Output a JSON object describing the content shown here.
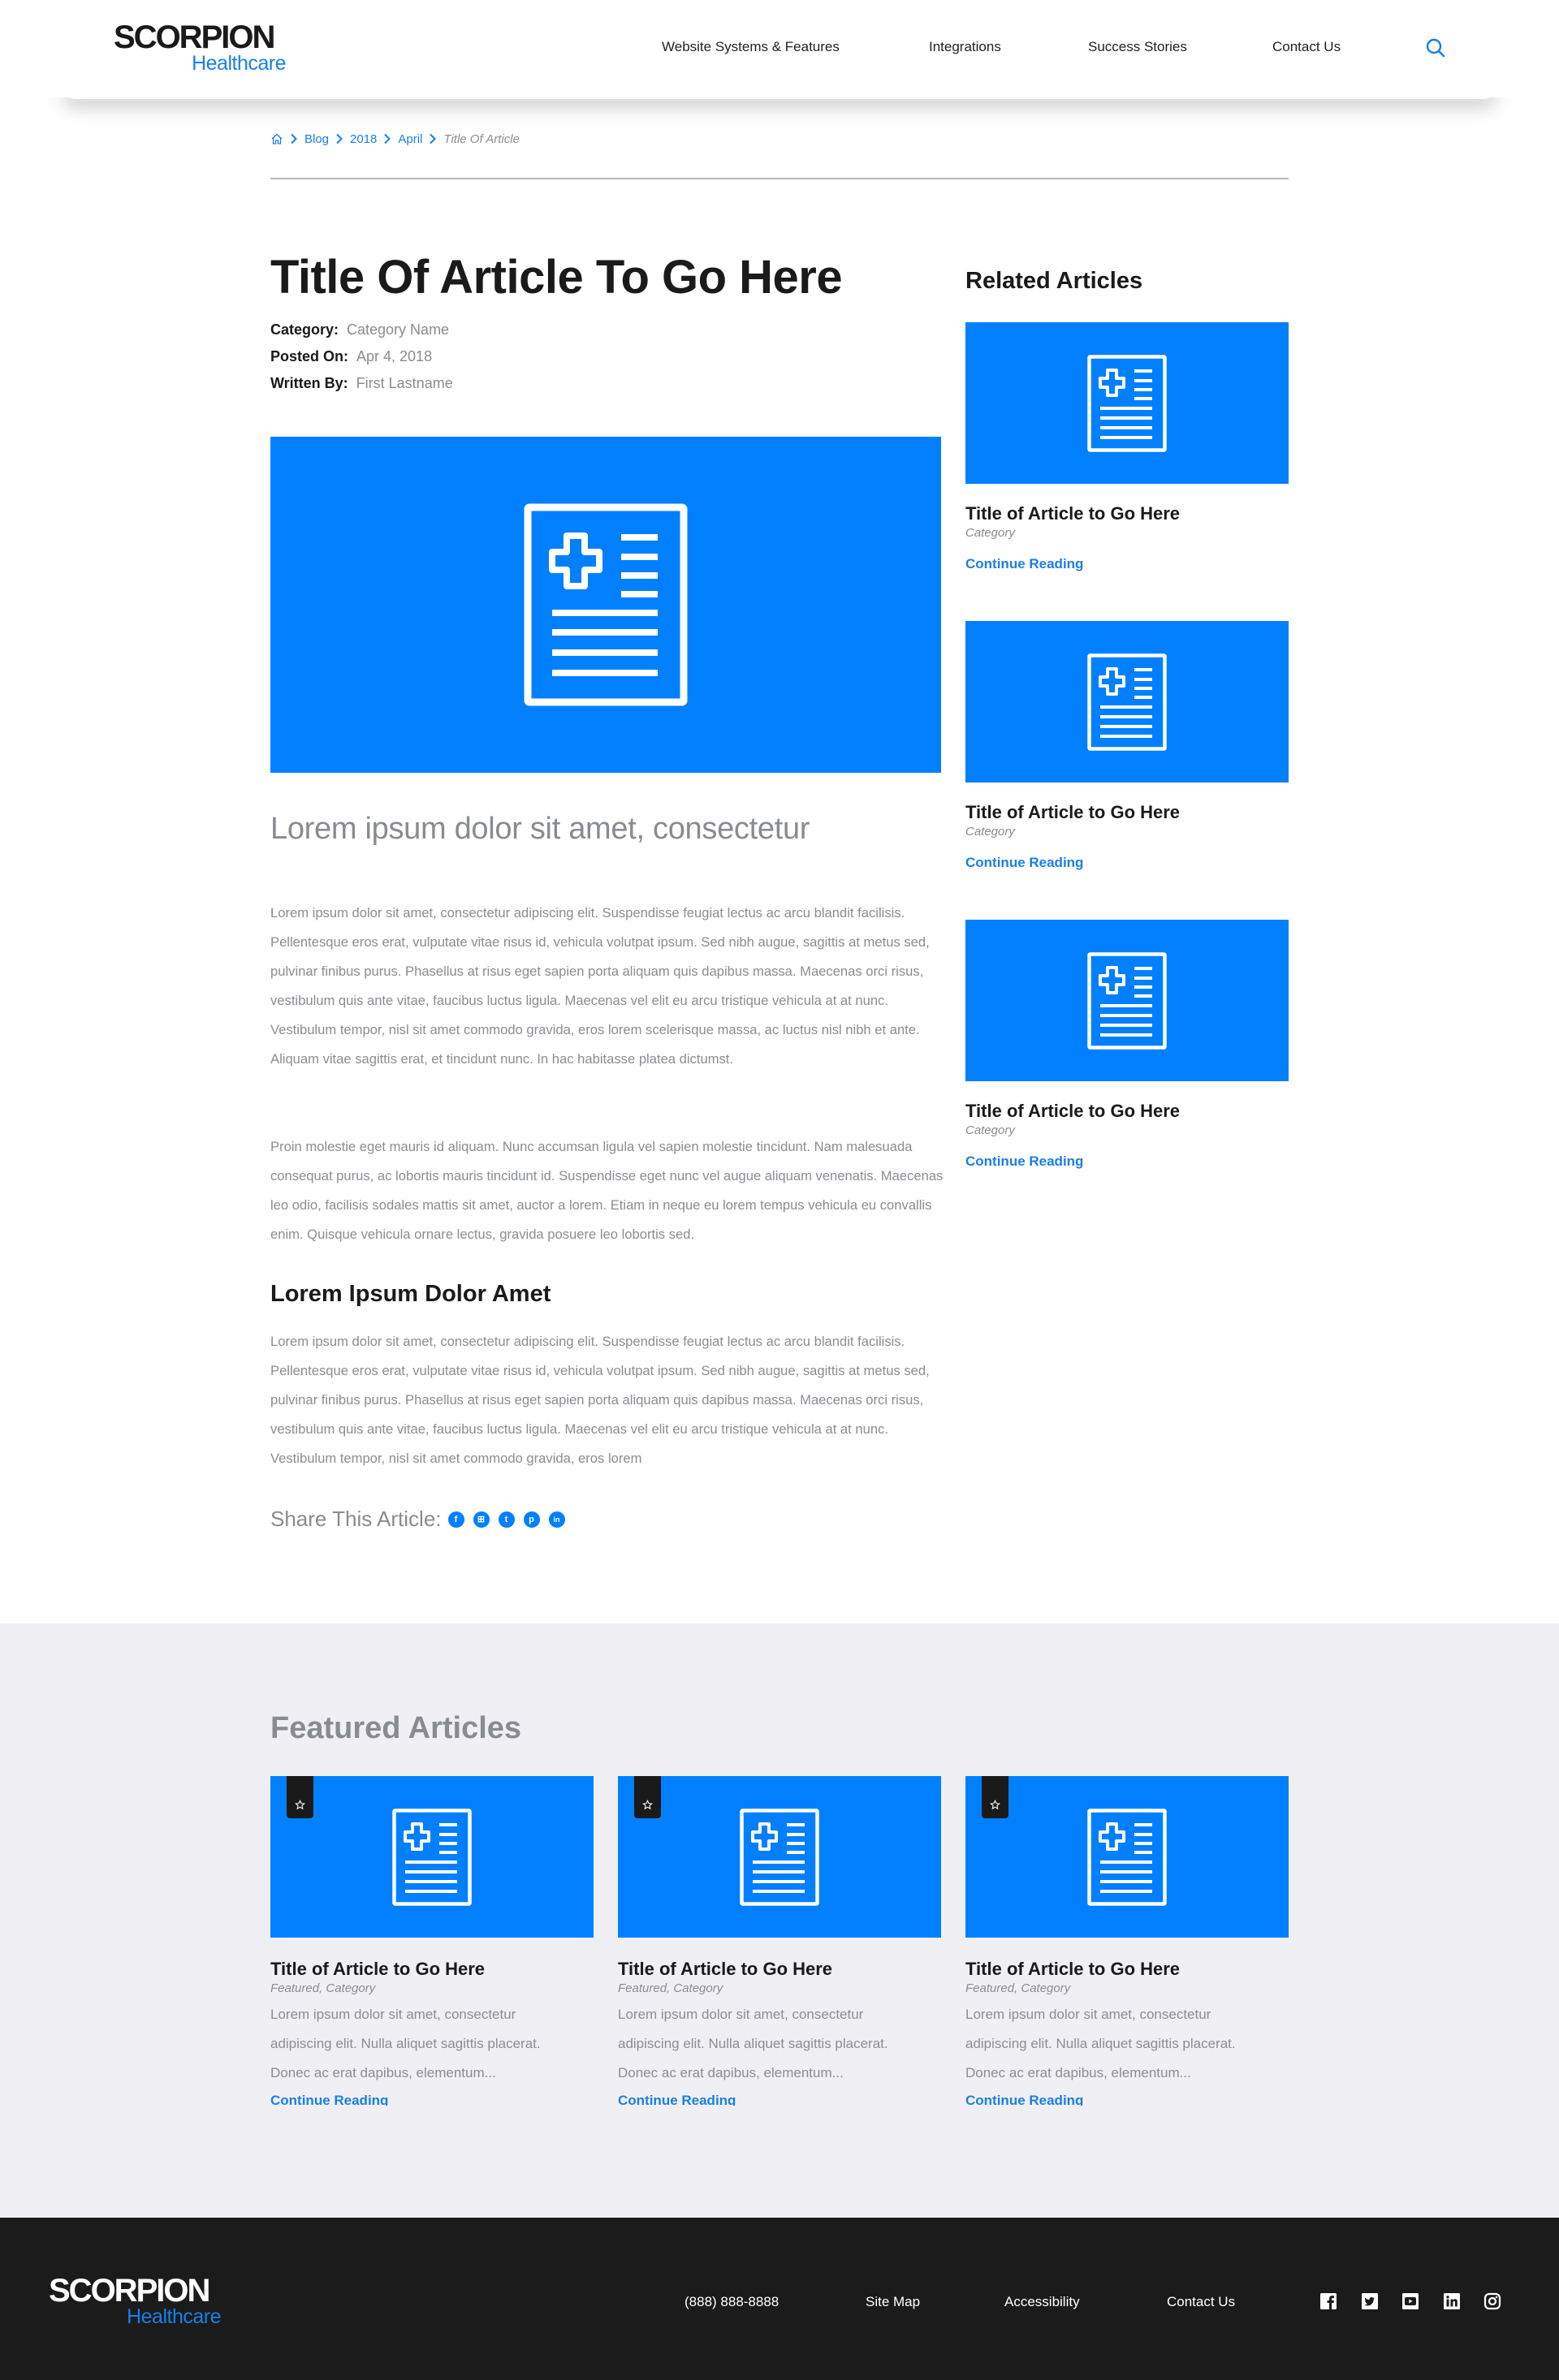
{
  "brand": {
    "name_top": "SCORPION",
    "name_bottom": "Healthcare",
    "accent_color": "#0080ff",
    "link_color": "#1a7fe8"
  },
  "header": {
    "nav": [
      {
        "label": "Website Systems & Features"
      },
      {
        "label": "Integrations"
      },
      {
        "label": "Success Stories"
      },
      {
        "label": "Contact Us"
      }
    ],
    "search_icon": "search-icon"
  },
  "breadcrumb": {
    "home_icon": "home-icon",
    "items": [
      {
        "label": "Blog"
      },
      {
        "label": "2018"
      },
      {
        "label": "April"
      }
    ],
    "current": "Title Of Article"
  },
  "article": {
    "title": "Title Of Article To Go Here",
    "meta": [
      {
        "label": "Category:",
        "value": "Category Name"
      },
      {
        "label": "Posted On:",
        "value": "Apr 4, 2018"
      },
      {
        "label": "Written By:",
        "value": "First Lastname"
      }
    ],
    "hero_icon": "medical-document-icon",
    "lead": "Lorem ipsum dolor sit amet, consectetur",
    "paragraphs": [
      "Lorem ipsum dolor sit amet, consectetur adipiscing elit. Suspendisse feugiat lectus ac arcu blandit facilisis. Pellentesque eros erat, vulputate vitae risus id, vehicula volutpat ipsum. Sed nibh augue, sagittis at metus sed, pulvinar finibus purus. Phasellus at risus eget sapien porta aliquam quis dapibus massa. Maecenas orci risus, vestibulum quis ante vitae, faucibus luctus ligula. Maecenas vel elit eu arcu tristique vehicula at at nunc. Vestibulum tempor, nisl sit amet commodo gravida, eros lorem scelerisque massa, ac luctus nisl nibh et ante. Aliquam vitae sagittis erat, et tincidunt nunc. In hac habitasse platea dictumst.",
      "Proin molestie eget mauris id aliquam. Nunc accumsan ligula vel sapien molestie tincidunt. Nam malesuada consequat purus, ac lobortis mauris tincidunt id. Suspendisse eget nunc vel augue aliquam venenatis. Maecenas leo odio, facilisis sodales mattis sit amet, auctor a lorem. Etiam in neque eu lorem tempus vehicula eu convallis enim. Quisque vehicula ornare lectus, gravida posuere leo lobortis sed."
    ],
    "sub_heading": "Lorem Ipsum Dolor Amet",
    "sub_paragraph": "Lorem ipsum dolor sit amet, consectetur adipiscing elit. Suspendisse feugiat lectus ac arcu blandit facilisis. Pellentesque eros erat, vulputate vitae risus id, vehicula volutpat ipsum. Sed nibh augue, sagittis at metus sed, pulvinar finibus purus. Phasellus at risus eget sapien porta aliquam quis dapibus massa. Maecenas orci risus, vestibulum quis ante vitae, faucibus luctus ligula. Maecenas vel elit eu arcu tristique vehicula at at nunc. Vestibulum tempor, nisl sit amet commodo gravida, eros lorem",
    "share": {
      "label": "Share This Article:",
      "buttons": [
        {
          "icon": "facebook-icon",
          "glyph": "f"
        },
        {
          "icon": "google-my-business-icon",
          "glyph": "⊞"
        },
        {
          "icon": "twitter-icon",
          "glyph": "t"
        },
        {
          "icon": "pinterest-icon",
          "glyph": "p"
        },
        {
          "icon": "linkedin-icon",
          "glyph": "in"
        }
      ]
    }
  },
  "sidebar": {
    "title": "Related Articles",
    "cards": [
      {
        "title": "Title of Article to Go Here",
        "category": "Category",
        "link": "Continue Reading"
      },
      {
        "title": "Title of Article to Go Here",
        "category": "Category",
        "link": "Continue Reading"
      },
      {
        "title": "Title of Article to Go Here",
        "category": "Category",
        "link": "Continue Reading"
      }
    ]
  },
  "featured": {
    "title": "Featured Articles",
    "cards": [
      {
        "title": "Title of Article to Go Here",
        "category": "Featured, Category",
        "excerpt": "Lorem ipsum dolor sit amet, consectetur adipiscing elit. Nulla aliquet sagittis placerat. Donec ac erat dapibus, elementum...",
        "link": "Continue Reading",
        "badge_icon": "star-icon"
      },
      {
        "title": "Title of Article to Go Here",
        "category": "Featured, Category",
        "excerpt": "Lorem ipsum dolor sit amet, consectetur adipiscing elit. Nulla aliquet sagittis placerat. Donec ac erat dapibus, elementum...",
        "link": "Continue Reading",
        "badge_icon": "star-icon"
      },
      {
        "title": "Title of Article to Go Here",
        "category": "Featured, Category",
        "excerpt": "Lorem ipsum dolor sit amet, consectetur adipiscing elit. Nulla aliquet sagittis placerat. Donec ac erat dapibus, elementum...",
        "link": "Continue Reading",
        "badge_icon": "star-icon"
      }
    ]
  },
  "footer": {
    "phone": "(888) 888-8888",
    "links": [
      {
        "label": "Site Map"
      },
      {
        "label": "Accessibility"
      },
      {
        "label": "Contact Us"
      }
    ],
    "social": [
      "facebook-icon",
      "twitter-icon",
      "youtube-icon",
      "linkedin-icon",
      "instagram-icon"
    ]
  }
}
